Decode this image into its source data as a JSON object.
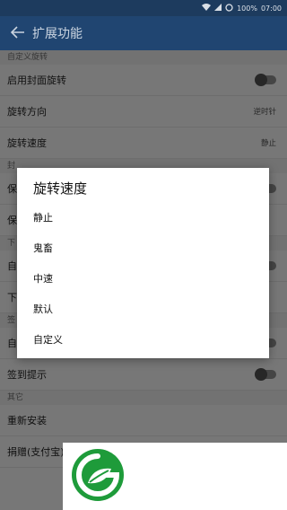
{
  "status_bar": {
    "battery": "100%",
    "time": "07:00"
  },
  "app_bar": {
    "title": "扩展功能"
  },
  "settings": {
    "sections": [
      {
        "header": "自定义旋转",
        "rows": [
          {
            "label": "启用封面旋转",
            "type": "toggle",
            "on": false
          },
          {
            "label": "旋转方向",
            "type": "value",
            "value": "逆时针"
          },
          {
            "label": "旋转速度",
            "type": "value",
            "value": "静止"
          }
        ]
      },
      {
        "header": "封",
        "rows": [
          {
            "label": "保",
            "type": "toggle",
            "on": false
          },
          {
            "label": "保",
            "type": "none"
          }
        ]
      },
      {
        "header": "下",
        "rows": [
          {
            "label": "自",
            "type": "toggle",
            "on": false
          },
          {
            "label": "下",
            "type": "none"
          }
        ]
      },
      {
        "header": "签",
        "rows": [
          {
            "label": "自动签到",
            "type": "toggle",
            "on": false
          },
          {
            "label": "签到提示",
            "type": "toggle",
            "on": false
          }
        ]
      },
      {
        "header": "其它",
        "rows": [
          {
            "label": "重新安装",
            "type": "none"
          },
          {
            "label": "捐赠(支付宝)",
            "type": "none"
          }
        ]
      }
    ]
  },
  "dialog": {
    "title": "旋转速度",
    "options": [
      "静止",
      "鬼畜",
      "中速",
      "默认",
      "自定义"
    ]
  },
  "colors": {
    "accent": "#224a79",
    "status_bar": "#1f3f64",
    "logo_green": "#1e9b3a"
  },
  "icons": {
    "back": "arrow-left-icon",
    "wifi": "wifi-icon",
    "signal": "signal-icon",
    "battery": "battery-icon",
    "logo": "leaf-g-logo-icon"
  }
}
